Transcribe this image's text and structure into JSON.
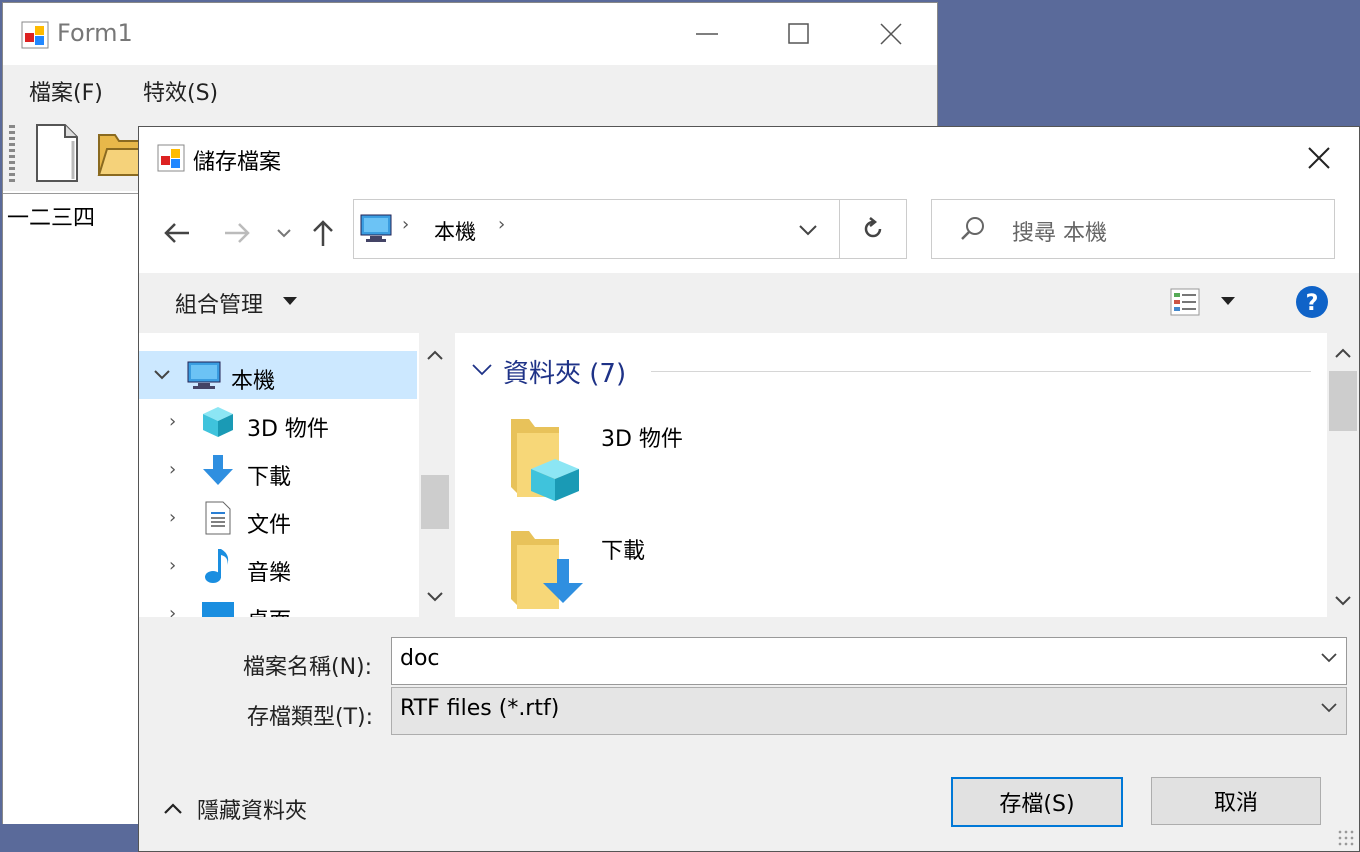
{
  "form1": {
    "title": "Form1",
    "menu": [
      "檔案(F)",
      "特效(S)"
    ],
    "richtext_content": "一二三四"
  },
  "dialog": {
    "title": "儲存檔案",
    "address": {
      "location": "本機"
    },
    "search": {
      "placeholder": "搜尋 本機"
    },
    "organize_label": "組合管理",
    "tree": [
      {
        "label": "本機",
        "icon": "computer-icon",
        "expanded": true,
        "selected": true
      },
      {
        "label": "3D 物件",
        "icon": "3d-objects-icon"
      },
      {
        "label": "下載",
        "icon": "download-icon"
      },
      {
        "label": "文件",
        "icon": "document-icon"
      },
      {
        "label": "音樂",
        "icon": "music-icon"
      },
      {
        "label": "桌面",
        "icon": "desktop-icon"
      }
    ],
    "group_header": "資料夾 (7)",
    "folders": [
      {
        "label": "3D 物件",
        "icon": "3d-objects-folder-icon"
      },
      {
        "label": "下載",
        "icon": "download-folder-icon"
      }
    ],
    "filename_label": "檔案名稱(N):",
    "filename_value": "doc",
    "filetype_label": "存檔類型(T):",
    "filetype_value": "RTF files (*.rtf)",
    "hide_folders_label": "隱藏資料夾",
    "save_label": "存檔(S)",
    "cancel_label": "取消"
  },
  "colors": {
    "accent": "#0078d7",
    "selection": "#cce8ff",
    "desktop": "#5a6a9a",
    "group_header": "#1e3287"
  }
}
